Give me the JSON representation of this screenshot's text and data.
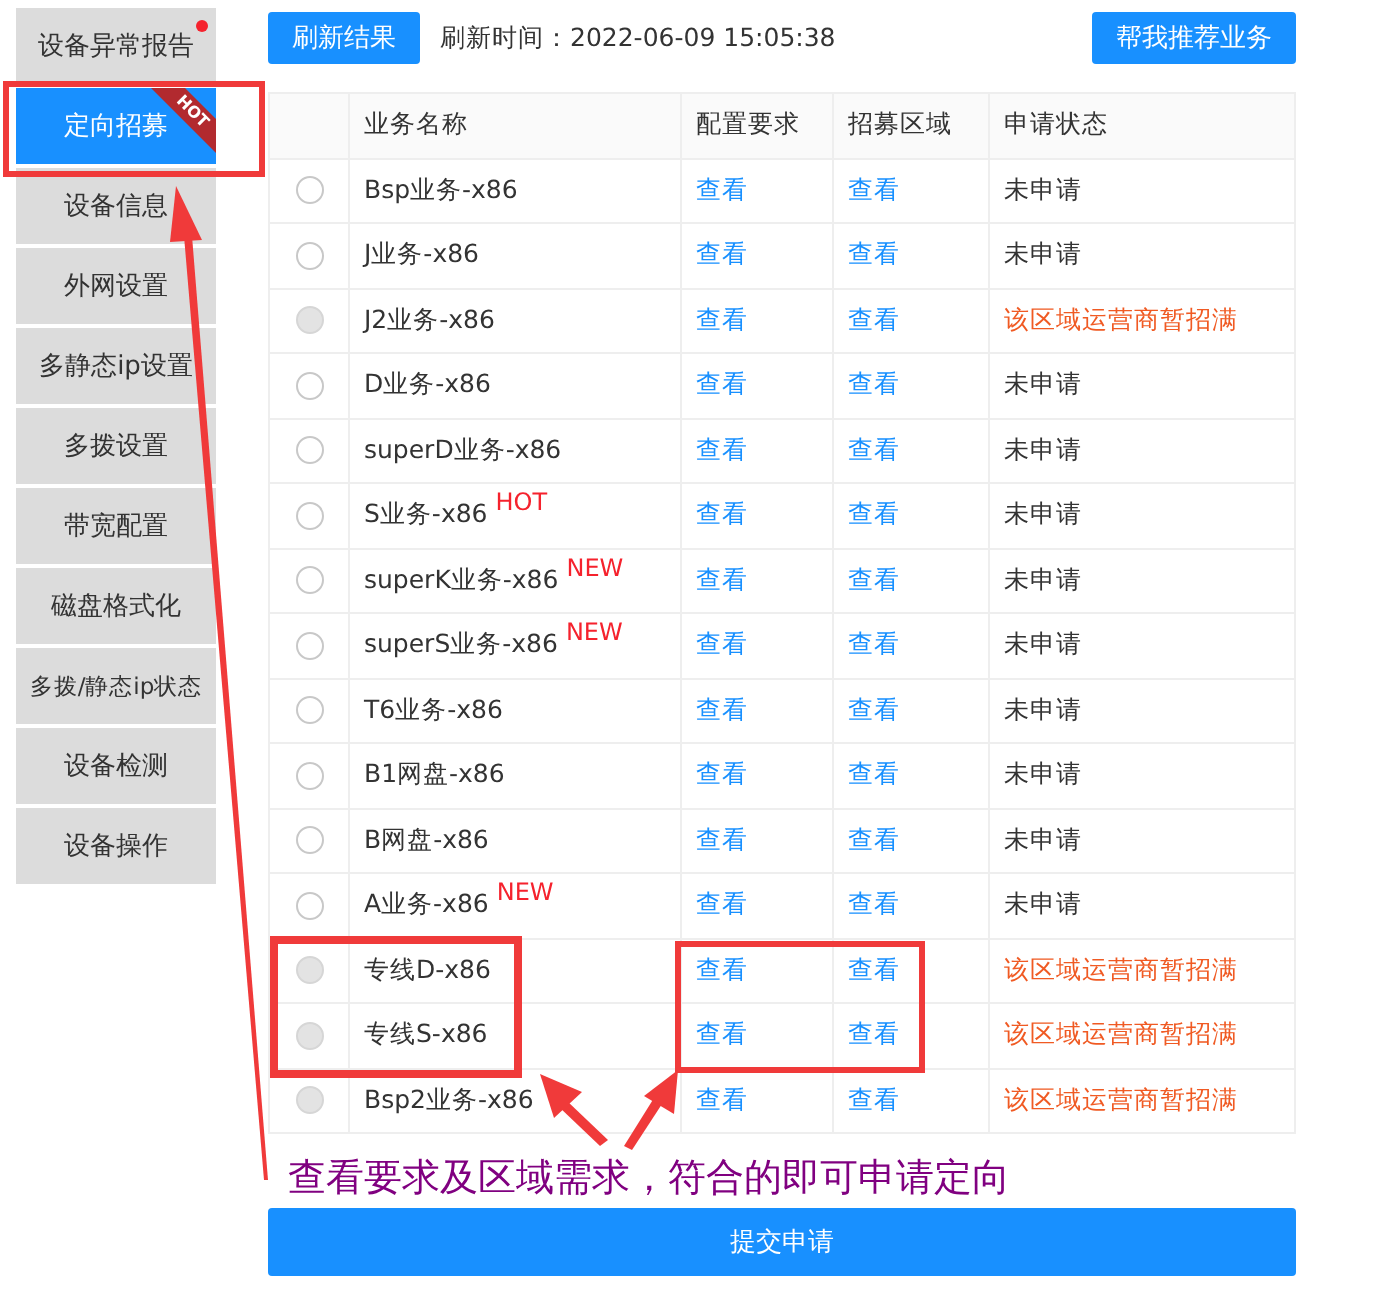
{
  "sidebar": {
    "items": [
      {
        "label": "设备异常报告",
        "selected": false,
        "dot": true
      },
      {
        "label": "定向招募",
        "selected": true,
        "ribbon": "HOT"
      },
      {
        "label": "设备信息",
        "selected": false
      },
      {
        "label": "外网设置",
        "selected": false
      },
      {
        "label": "多静态ip设置",
        "selected": false
      },
      {
        "label": "多拨设置",
        "selected": false
      },
      {
        "label": "带宽配置",
        "selected": false
      },
      {
        "label": "磁盘格式化",
        "selected": false
      },
      {
        "label": "多拨/静态ip状态",
        "selected": false
      },
      {
        "label": "设备检测",
        "selected": false
      },
      {
        "label": "设备操作",
        "selected": false
      }
    ]
  },
  "toolbar": {
    "refresh_button": "刷新结果",
    "refresh_time": "刷新时间：2022-06-09 15:05:38",
    "recommend_button": "帮我推荐业务"
  },
  "table": {
    "columns": [
      "业务名称",
      "配置要求",
      "招募区域",
      "申请状态"
    ],
    "rows": [
      {
        "name": "Bsp业务-x86",
        "config": "查看",
        "region": "查看",
        "status": "未申请",
        "full": false,
        "disabled": false
      },
      {
        "name": "J业务-x86",
        "config": "查看",
        "region": "查看",
        "status": "未申请",
        "full": false,
        "disabled": false
      },
      {
        "name": "J2业务-x86",
        "config": "查看",
        "region": "查看",
        "status": "该区域运营商暂招满",
        "full": true,
        "disabled": true
      },
      {
        "name": "D业务-x86",
        "config": "查看",
        "region": "查看",
        "status": "未申请",
        "full": false,
        "disabled": false
      },
      {
        "name": "superD业务-x86",
        "config": "查看",
        "region": "查看",
        "status": "未申请",
        "full": false,
        "disabled": false
      },
      {
        "name": "S业务-x86",
        "badge": "HOT",
        "config": "查看",
        "region": "查看",
        "status": "未申请",
        "full": false,
        "disabled": false
      },
      {
        "name": "superK业务-x86",
        "badge": "NEW",
        "config": "查看",
        "region": "查看",
        "status": "未申请",
        "full": false,
        "disabled": false
      },
      {
        "name": "superS业务-x86",
        "badge": "NEW",
        "config": "查看",
        "region": "查看",
        "status": "未申请",
        "full": false,
        "disabled": false
      },
      {
        "name": "T6业务-x86",
        "config": "查看",
        "region": "查看",
        "status": "未申请",
        "full": false,
        "disabled": false
      },
      {
        "name": "B1网盘-x86",
        "config": "查看",
        "region": "查看",
        "status": "未申请",
        "full": false,
        "disabled": false
      },
      {
        "name": "B网盘-x86",
        "config": "查看",
        "region": "查看",
        "status": "未申请",
        "full": false,
        "disabled": false
      },
      {
        "name": "A业务-x86",
        "badge": "NEW",
        "config": "查看",
        "region": "查看",
        "status": "未申请",
        "full": false,
        "disabled": false
      },
      {
        "name": "专线D-x86",
        "config": "查看",
        "region": "查看",
        "status": "该区域运营商暂招满",
        "full": true,
        "disabled": true
      },
      {
        "name": "专线S-x86",
        "config": "查看",
        "region": "查看",
        "status": "该区域运营商暂招满",
        "full": true,
        "disabled": true
      },
      {
        "name": "Bsp2业务-x86",
        "config": "查看",
        "region": "查看",
        "status": "该区域运营商暂招满",
        "full": true,
        "disabled": true
      }
    ]
  },
  "annotation": {
    "caption": "查看要求及区域需求，符合的即可申请定向"
  },
  "submit_button": "提交申请"
}
